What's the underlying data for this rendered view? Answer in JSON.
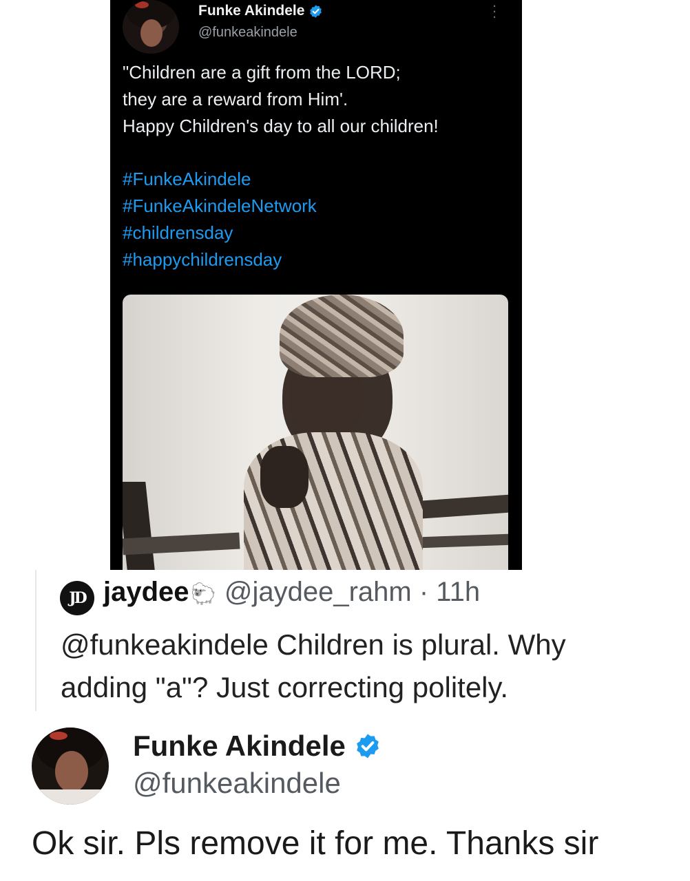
{
  "original_tweet": {
    "name": "Funke Akindele",
    "handle": "@funkeakindele",
    "lines": [
      "\"Children are a gift from the LORD;",
      "they are a reward from Him'.",
      "Happy Children's day to all our children!"
    ],
    "hashtags": [
      "#FunkeAkindele",
      "#FunkeAkindeleNetwork",
      "#childrensday",
      "#happychildrensday"
    ],
    "more_icon": "more-vertical-icon",
    "verified_icon": "verified-badge-icon"
  },
  "reply": {
    "logo_text": "JD",
    "name": "jaydee",
    "emoji": "🐑",
    "handle_time": "@jaydee_rahm · 11h",
    "lines": [
      "@funkeakindele Children is plural. Why",
      "adding \"a\"? Just correcting politely."
    ]
  },
  "response": {
    "name": "Funke Akindele",
    "handle": "@funkeakindele",
    "text": "Ok sir. Pls remove it for me. Thanks sir",
    "verified_icon": "verified-badge-icon"
  },
  "colors": {
    "dark_bg": "#000000",
    "hashtag": "#1d9bf0",
    "verified": "#1d9bf0"
  }
}
